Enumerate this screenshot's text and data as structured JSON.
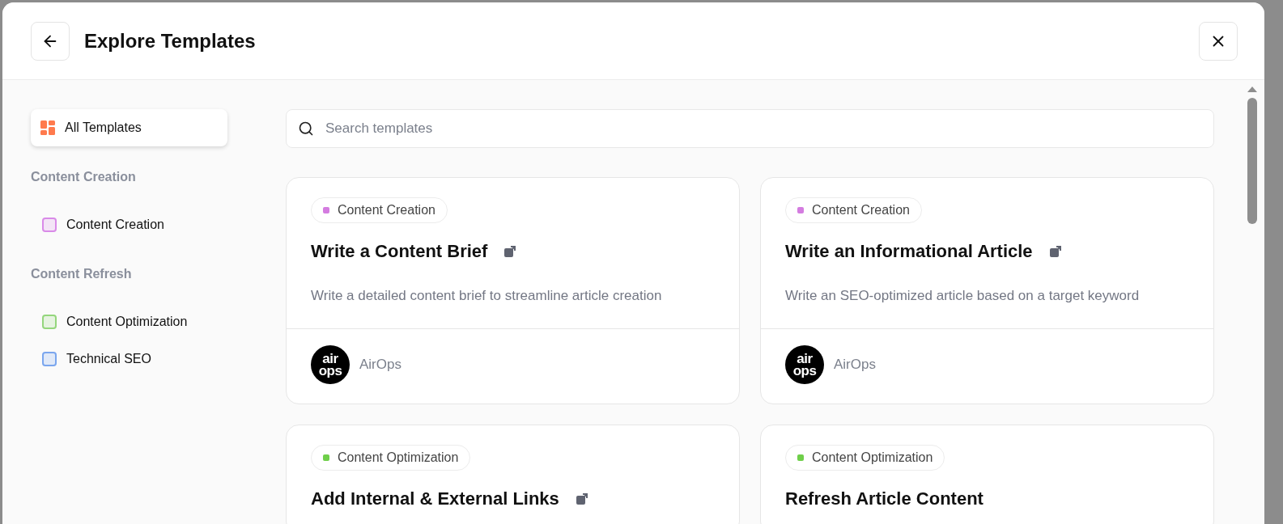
{
  "window": {
    "title": "Explore Templates"
  },
  "sidebar": {
    "items": [
      {
        "kind": "all",
        "label": "All Templates",
        "selected": true
      },
      {
        "kind": "heading",
        "label": "Content Creation"
      },
      {
        "kind": "category",
        "label": "Content Creation",
        "color": "#d98ae8"
      },
      {
        "kind": "heading",
        "label": "Content Refresh"
      },
      {
        "kind": "category",
        "label": "Content Optimization",
        "color": "#94d67c"
      },
      {
        "kind": "category",
        "label": "Technical SEO",
        "color": "#7aa6ee"
      }
    ]
  },
  "search": {
    "placeholder": "Search templates"
  },
  "templates": [
    {
      "tag": "Content Creation",
      "color": "#d47ce0",
      "title": "Write a Content Brief",
      "external_link": true,
      "description": "Write a detailed content brief to streamline article creation",
      "logo": [
        "air",
        "ops"
      ],
      "author": "AirOps"
    },
    {
      "tag": "Content Creation",
      "color": "#d47ce0",
      "title": "Write an Informational Article",
      "external_link": true,
      "description": "Write an SEO-optimized article based on a target keyword",
      "logo": [
        "air",
        "ops"
      ],
      "author": "AirOps"
    },
    {
      "tag": "Content Optimization",
      "color": "#6fcf4a",
      "title": "Add Internal & External Links",
      "external_link": true
    },
    {
      "tag": "Content Optimization",
      "color": "#6fcf4a",
      "title": "Refresh Article Content",
      "external_link": false
    }
  ]
}
